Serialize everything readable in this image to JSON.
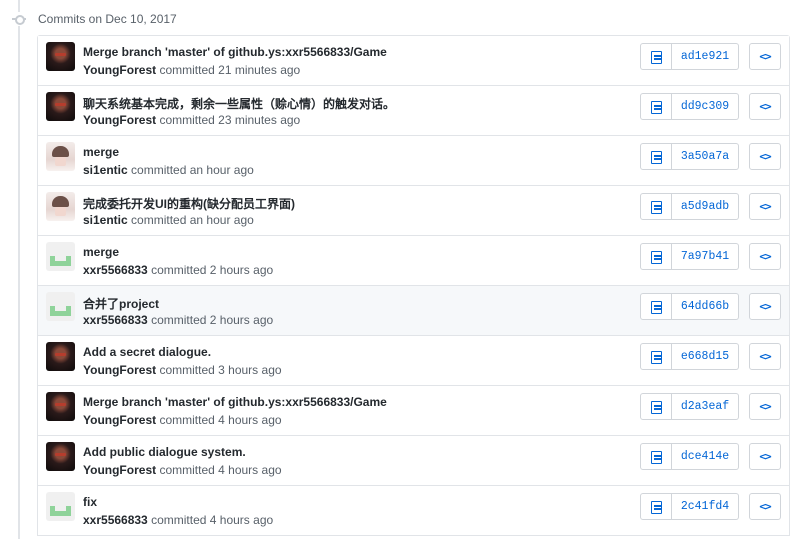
{
  "group": {
    "title": "Commits on Dec 10, 2017"
  },
  "commits": [
    {
      "message": "Merge branch 'master' of github.ys:xxr5566833/Game",
      "author": "YoungForest",
      "verb": "committed",
      "time": "21 minutes ago",
      "sha": "ad1e921",
      "avatar": "young-forest-avatar"
    },
    {
      "message": "聊天系统基本完成，剩余一些属性（赊心情）的触发对话。",
      "author": "YoungForest",
      "verb": "committed",
      "time": "23 minutes ago",
      "sha": "dd9c309",
      "avatar": "young-forest-avatar"
    },
    {
      "message": "merge",
      "author": "si1entic",
      "verb": "committed",
      "time": "an hour ago",
      "sha": "3a50a7a",
      "avatar": "si1entic-avatar"
    },
    {
      "message": "完成委托开发UI的重构(缺分配员工界面)",
      "author": "si1entic",
      "verb": "committed",
      "time": "an hour ago",
      "sha": "a5d9adb",
      "avatar": "si1entic-avatar"
    },
    {
      "message": "merge",
      "author": "xxr5566833",
      "verb": "committed",
      "time": "2 hours ago",
      "sha": "7a97b41",
      "avatar": "identicon-avatar"
    },
    {
      "message": "合并了project",
      "author": "xxr5566833",
      "verb": "committed",
      "time": "2 hours ago",
      "sha": "64dd66b",
      "avatar": "identicon-avatar"
    },
    {
      "message": "Add a secret dialogue.",
      "author": "YoungForest",
      "verb": "committed",
      "time": "3 hours ago",
      "sha": "e668d15",
      "avatar": "young-forest-avatar"
    },
    {
      "message": "Merge branch 'master' of github.ys:xxr5566833/Game",
      "author": "YoungForest",
      "verb": "committed",
      "time": "4 hours ago",
      "sha": "d2a3eaf",
      "avatar": "young-forest-avatar"
    },
    {
      "message": "Add public dialogue system.",
      "author": "YoungForest",
      "verb": "committed",
      "time": "4 hours ago",
      "sha": "dce414e",
      "avatar": "young-forest-avatar"
    },
    {
      "message": "fix",
      "author": "xxr5566833",
      "verb": "committed",
      "time": "4 hours ago",
      "sha": "2c41fd4",
      "avatar": "identicon-avatar"
    }
  ],
  "icons": {
    "copy": "clipboard-icon",
    "browse": "code-icon",
    "group": "git-commit-icon"
  },
  "colors": {
    "link": "#0366d6",
    "border": "#e1e4e8",
    "identicon": "#8fd39a",
    "highlight_row": "#f6f8fa"
  }
}
